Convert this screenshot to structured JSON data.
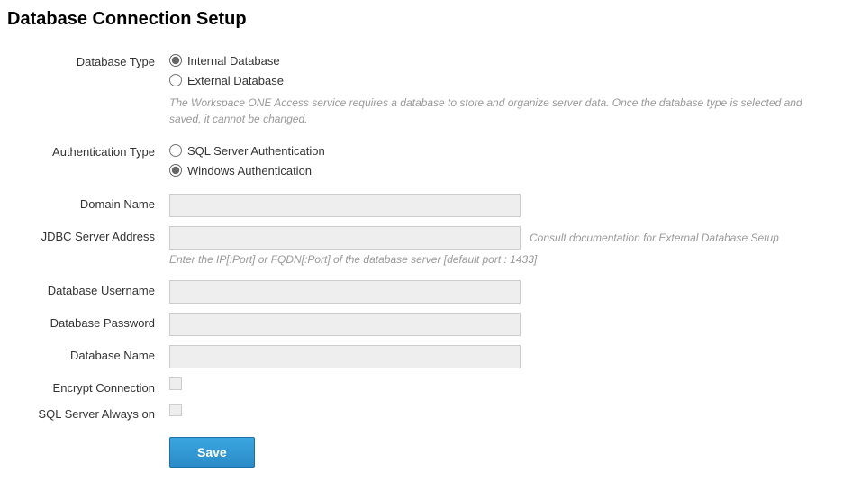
{
  "page": {
    "title": "Database Connection Setup"
  },
  "databaseType": {
    "label": "Database Type",
    "options": {
      "internal": "Internal Database",
      "external": "External Database"
    },
    "hint": "The Workspace ONE Access service requires a database to store and organize server data. Once the database type is selected and saved, it cannot be changed."
  },
  "authType": {
    "label": "Authentication Type",
    "options": {
      "sql": "SQL Server Authentication",
      "windows": "Windows Authentication"
    }
  },
  "domainName": {
    "label": "Domain Name",
    "value": ""
  },
  "jdbcAddress": {
    "label": "JDBC Server Address",
    "value": "",
    "sideHint": "Consult documentation for External Database Setup",
    "belowHint": "Enter the IP[:Port] or FQDN[:Port] of the database server [default port : 1433]"
  },
  "dbUsername": {
    "label": "Database Username",
    "value": ""
  },
  "dbPassword": {
    "label": "Database Password",
    "value": ""
  },
  "dbName": {
    "label": "Database Name",
    "value": ""
  },
  "encrypt": {
    "label": "Encrypt Connection"
  },
  "alwaysOn": {
    "label": "SQL Server Always on"
  },
  "actions": {
    "save": "Save"
  }
}
